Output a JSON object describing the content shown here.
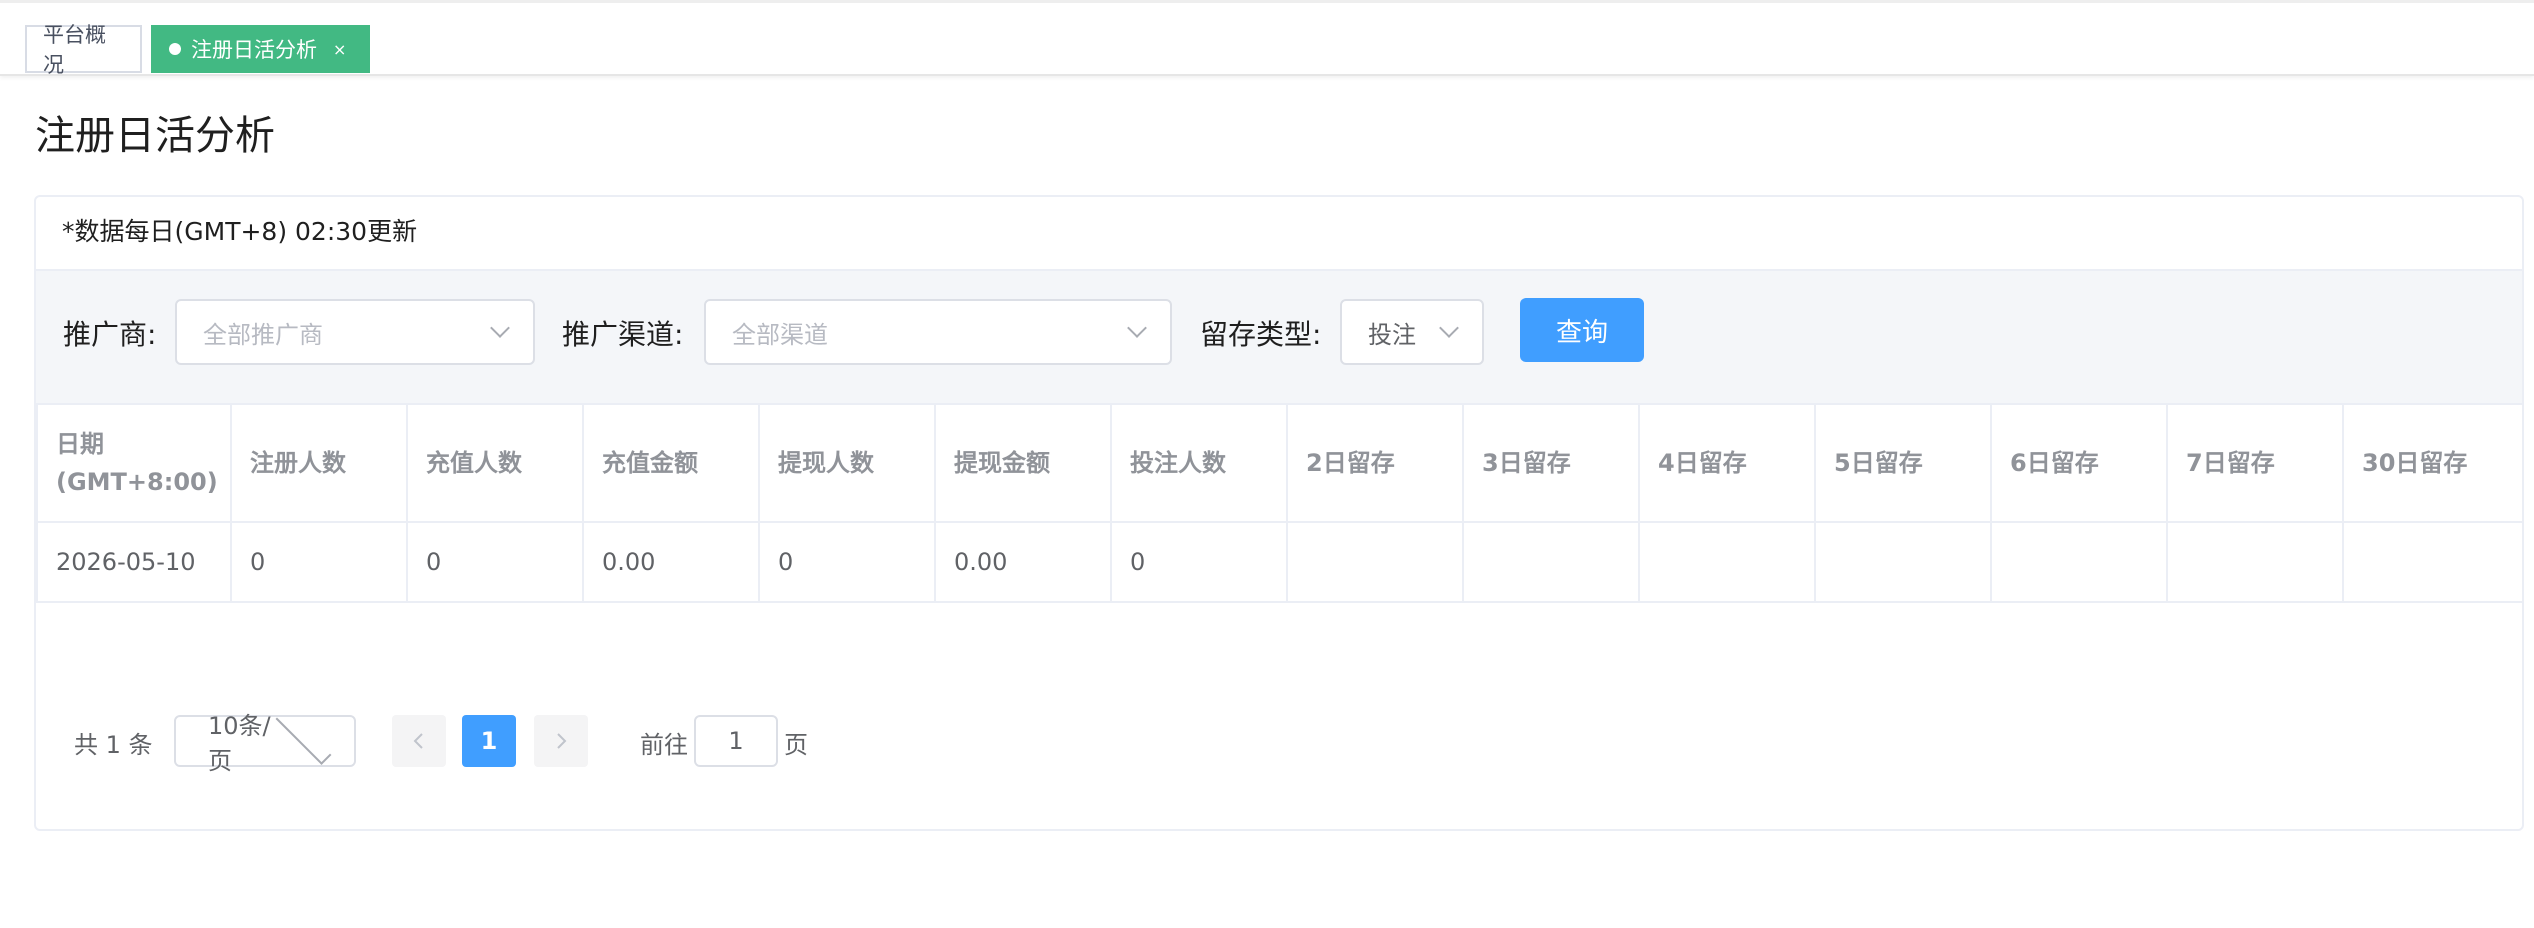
{
  "tags": {
    "overview": "平台概况",
    "active": "注册日活分析",
    "close": "×"
  },
  "page": {
    "title": "注册日活分析",
    "notice": "*数据每日(GMT+8) 02:30更新"
  },
  "filters": {
    "promoter_label": "推广商:",
    "promoter_placeholder": "全部推广商",
    "channel_label": "推广渠道:",
    "channel_placeholder": "全部渠道",
    "retention_label": "留存类型:",
    "retention_value": "投注",
    "query_button": "查询"
  },
  "table": {
    "columns": [
      "日期(GMT+8:00)",
      "注册人数",
      "充值人数",
      "充值金额",
      "提现人数",
      "提现金额",
      "投注人数",
      "2日留存",
      "3日留存",
      "4日留存",
      "5日留存",
      "6日留存",
      "7日留存",
      "30日留存"
    ],
    "rows": [
      [
        "2026-05-10",
        "0",
        "0",
        "0.00",
        "0",
        "0.00",
        "0",
        "",
        "",
        "",
        "",
        "",
        "",
        ""
      ]
    ]
  },
  "pagination": {
    "total_text": "共 1 条",
    "page_size": "10条/页",
    "prev_icon": "chevron-left-icon",
    "next_icon": "chevron-right-icon",
    "current_page": "1",
    "goto_label": "前往",
    "goto_value": "1",
    "page_suffix": "页"
  },
  "colors": {
    "tag_active": "#42b983",
    "primary": "#409eff",
    "filter_bg": "#f4f6f9"
  }
}
